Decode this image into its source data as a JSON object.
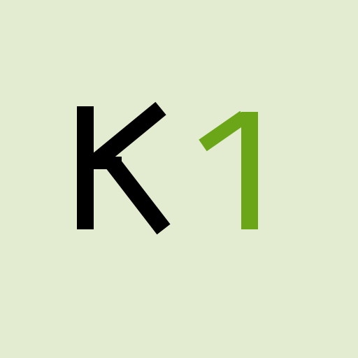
{
  "logo": {
    "letter": "K",
    "number": "1",
    "letter_color": "#000000",
    "number_color": "#6aa617",
    "background_color": "#e3ecd0"
  }
}
